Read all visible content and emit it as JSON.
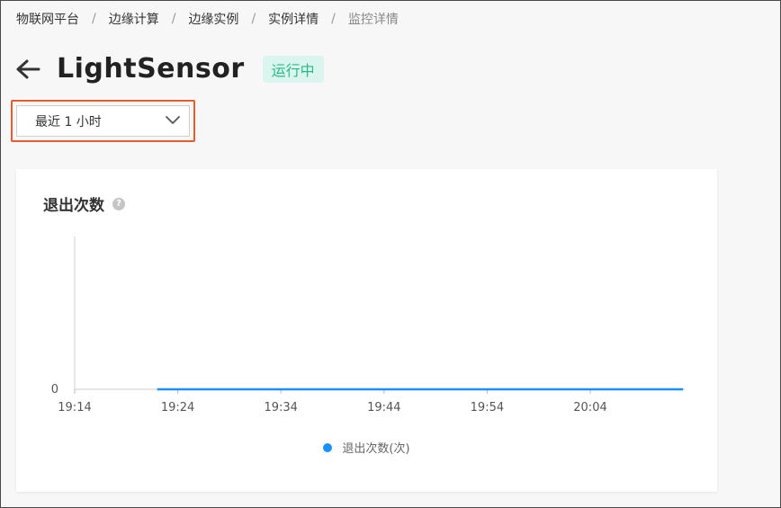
{
  "breadcrumb": {
    "items": [
      "物联网平台",
      "边缘计算",
      "边缘实例",
      "实例详情",
      "监控详情"
    ],
    "separator": "/"
  },
  "header": {
    "title": "LightSensor",
    "status": "运行中",
    "back_icon": "arrow-left-icon"
  },
  "range_select": {
    "value": "最近 1 小时",
    "icon": "chevron-down-icon"
  },
  "chart_card": {
    "title": "退出次数",
    "help_icon": "?"
  },
  "colors": {
    "accent": "#1890ff",
    "status_bg": "#d9f5ee",
    "status_text": "#2bb889",
    "highlight_border": "#e45c2c"
  },
  "chart_data": {
    "type": "line",
    "title": "退出次数",
    "xlabel": "",
    "ylabel": "",
    "x_ticks": [
      "19:14",
      "19:24",
      "19:34",
      "19:44",
      "19:54",
      "20:04"
    ],
    "y_ticks": [
      "0"
    ],
    "ylim": [
      0,
      1
    ],
    "grid": false,
    "legend_position": "bottom",
    "series": [
      {
        "name": "退出次数(次)",
        "color": "#1890ff",
        "x": [
          "19:22",
          "20:13"
        ],
        "values": [
          0,
          0
        ]
      }
    ]
  }
}
